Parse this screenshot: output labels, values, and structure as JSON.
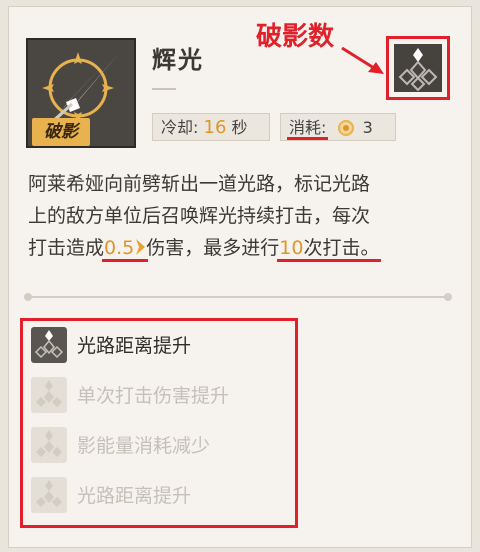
{
  "skill": {
    "name": "辉光",
    "break_tag": "破影",
    "cooldown_label": "冷却:",
    "cooldown_value": "16",
    "cooldown_unit": "秒",
    "cost_label": "消耗:",
    "cost_value": "3"
  },
  "annotation": {
    "label": "破影数"
  },
  "description": {
    "line1": "阿莱希娅向前劈斩出一道光路，标记光路",
    "line2": "上的敌方单位后召唤辉光持续打击，每次",
    "line3_a": "打击造成",
    "line3_mult": "0.5",
    "line3_b": "伤害，最多进行",
    "line3_hits": "10",
    "line3_c": "次打击。"
  },
  "upgrades": [
    {
      "label": "光路距离提升",
      "unlocked": true
    },
    {
      "label": "单次打击伤害提升",
      "unlocked": false
    },
    {
      "label": "影能量消耗减少",
      "unlocked": false
    },
    {
      "label": "光路距离提升",
      "unlocked": false
    }
  ],
  "colors": {
    "accent_orange": "#e0952a",
    "annotation_red": "#e0202a",
    "tag_gold": "#e8b24f"
  }
}
